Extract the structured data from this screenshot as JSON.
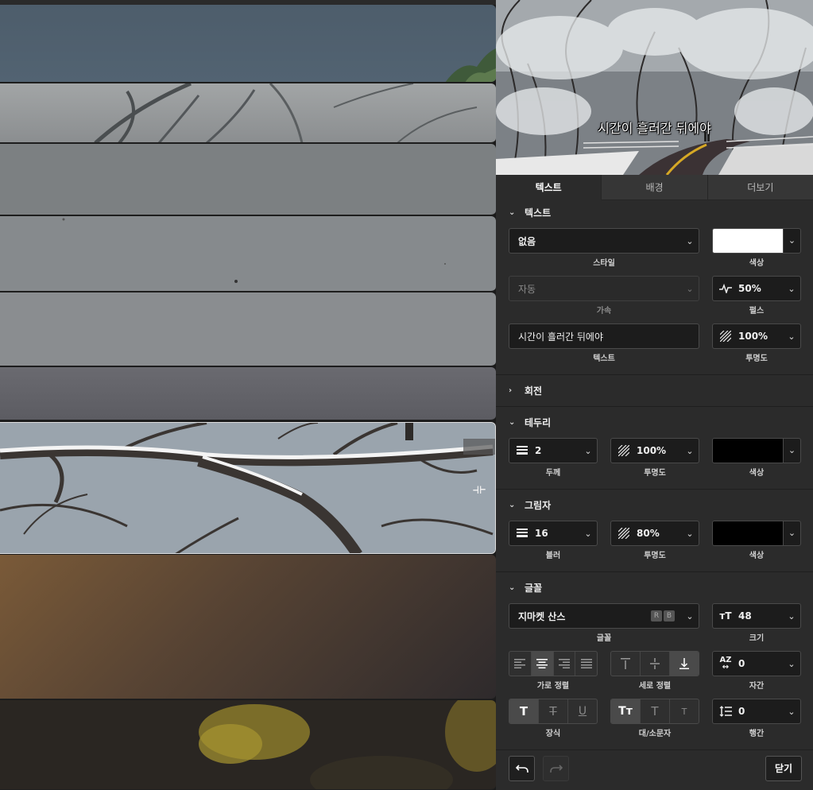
{
  "preview": {
    "caption": "시간이 흘러간 뒤에야"
  },
  "tabs": [
    {
      "label": "텍스트",
      "active": true
    },
    {
      "label": "배경",
      "active": false
    },
    {
      "label": "더보기",
      "active": false
    }
  ],
  "text_section": {
    "title": "텍스트",
    "style": {
      "value": "없음",
      "label": "스타일"
    },
    "color": {
      "value": "#ffffff",
      "label": "색상"
    },
    "easing": {
      "value": "자동",
      "label": "가속"
    },
    "pulse": {
      "value": "50%",
      "label": "펄스"
    },
    "text": {
      "value": "시간이 흘러간 뒤에야",
      "label": "텍스트"
    },
    "opacity": {
      "value": "100%",
      "label": "투명도"
    }
  },
  "rotation_section": {
    "title": "회전"
  },
  "border_section": {
    "title": "테두리",
    "thickness": {
      "value": "2",
      "label": "두께"
    },
    "opacity": {
      "value": "100%",
      "label": "투명도"
    },
    "color": {
      "value": "#000000",
      "label": "색상"
    }
  },
  "shadow_section": {
    "title": "그림자",
    "blur": {
      "value": "16",
      "label": "블러"
    },
    "opacity": {
      "value": "80%",
      "label": "투명도"
    },
    "color": {
      "value": "#000000",
      "label": "색상"
    }
  },
  "font_section": {
    "title": "글꼴",
    "font": {
      "value": "지마켓 산스",
      "label": "글꼴",
      "badges": [
        "R",
        "B"
      ]
    },
    "size": {
      "value": "48",
      "label": "크기"
    },
    "h_align": {
      "label": "가로 정렬",
      "selected": "center"
    },
    "v_align": {
      "label": "세로 정렬",
      "selected": "bottom"
    },
    "letter_spacing": {
      "value": "0",
      "label": "자간"
    },
    "decoration": {
      "label": "장식",
      "selected": "bold"
    },
    "case": {
      "label": "대/소문자",
      "selected": "mixed"
    },
    "line_spacing": {
      "value": "0",
      "label": "행간"
    }
  },
  "footer": {
    "close_label": "닫기"
  }
}
